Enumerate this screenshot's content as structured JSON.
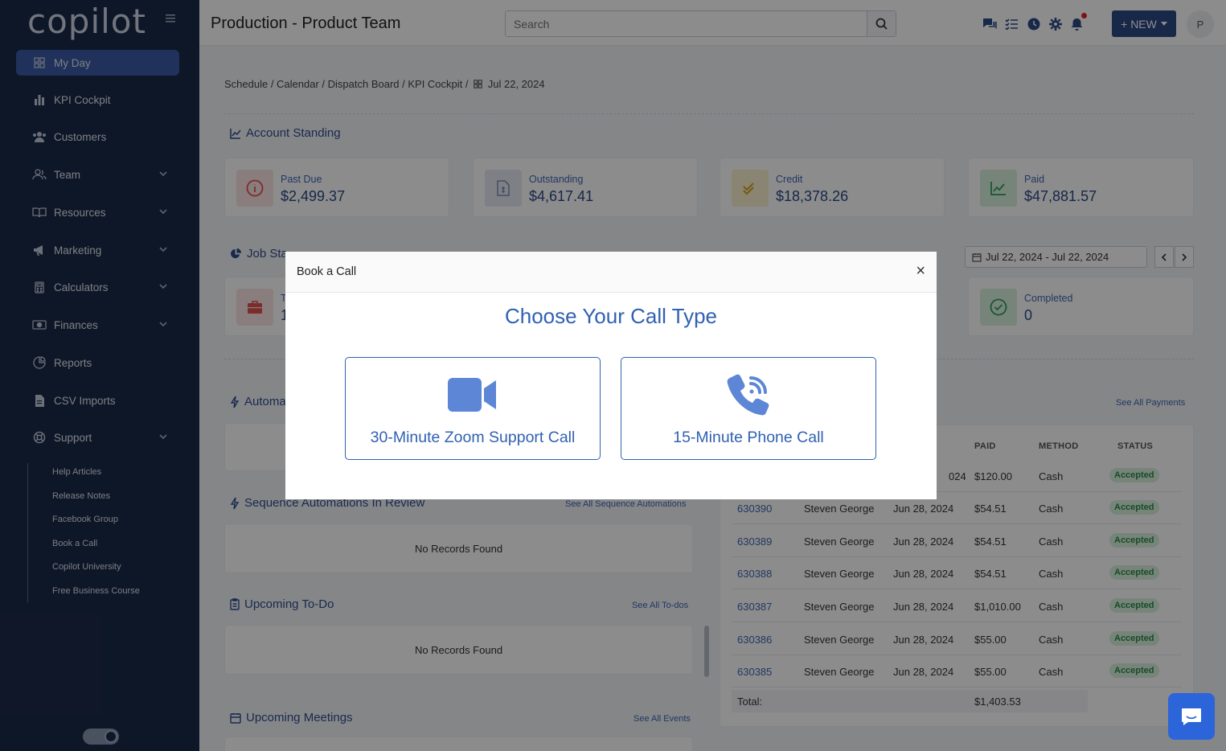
{
  "app": {
    "logo": "copilot",
    "page_title": "Production - Product Team"
  },
  "search": {
    "placeholder": "Search"
  },
  "header": {
    "new_label": "+ NEW",
    "avatar_initial": "P"
  },
  "sidebar": {
    "items": [
      {
        "label": "My Day",
        "icon": "grid-icon"
      },
      {
        "label": "KPI Cockpit",
        "icon": "bar-chart-icon"
      },
      {
        "label": "Customers",
        "icon": "users-icon"
      },
      {
        "label": "Team",
        "icon": "team-icon"
      },
      {
        "label": "Resources",
        "icon": "book-icon"
      },
      {
        "label": "Marketing",
        "icon": "megaphone-icon"
      },
      {
        "label": "Calculators",
        "icon": "calculator-icon"
      },
      {
        "label": "Finances",
        "icon": "money-icon"
      },
      {
        "label": "Reports",
        "icon": "pie-chart-icon"
      },
      {
        "label": "CSV Imports",
        "icon": "file-csv-icon"
      },
      {
        "label": "Support",
        "icon": "lifebuoy-icon"
      }
    ],
    "support_links": [
      "Help Articles",
      "Release Notes",
      "Facebook Group",
      "Book a Call",
      "Copilot University",
      "Free Business Course"
    ]
  },
  "breadcrumb": {
    "path": "Schedule / Calendar / Dispatch Board / KPI Cockpit /",
    "date": "Jul 22, 2024"
  },
  "account_standing": {
    "title": "Account Standing",
    "cards": [
      {
        "label": "Past Due",
        "value": "$2,499.37",
        "color": "#e05252"
      },
      {
        "label": "Outstanding",
        "value": "$4,617.41",
        "color": "#7c8db5"
      },
      {
        "label": "Credit",
        "value": "$18,378.26",
        "color": "#d4a418"
      },
      {
        "label": "Paid",
        "value": "$47,881.57",
        "color": "#2e9e5b"
      }
    ]
  },
  "job_stats": {
    "title_visible": "Job Sta",
    "date_range": "Jul 22, 2024 - Jul 22, 2024",
    "first_card_label": "T",
    "first_card_value": "1",
    "completed_label": "Completed",
    "completed_value": "0"
  },
  "automations": {
    "title_visible": "Automa"
  },
  "sequence_automations": {
    "title": "Sequence Automations In Review",
    "link": "See All Sequence Automations",
    "empty": "No Records Found"
  },
  "upcoming_todo": {
    "title": "Upcoming To-Do",
    "link": "See All To-dos",
    "empty": "No Records Found"
  },
  "upcoming_meetings": {
    "title": "Upcoming Meetings",
    "link": "See All Events"
  },
  "payments": {
    "link": "See All Payments",
    "headers": [
      "PAID",
      "METHOD",
      "STATUS"
    ],
    "partial_first_row": {
      "date_tail": "024",
      "paid": "$120.00",
      "method": "Cash",
      "status": "Accepted"
    },
    "rows": [
      {
        "job": "630390",
        "customer": "Steven George",
        "date": "Jun 28, 2024",
        "paid": "$54.51",
        "method": "Cash",
        "status": "Accepted"
      },
      {
        "job": "630389",
        "customer": "Steven George",
        "date": "Jun 28, 2024",
        "paid": "$54.51",
        "method": "Cash",
        "status": "Accepted"
      },
      {
        "job": "630388",
        "customer": "Steven George",
        "date": "Jun 28, 2024",
        "paid": "$54.51",
        "method": "Cash",
        "status": "Accepted"
      },
      {
        "job": "630387",
        "customer": "Steven George",
        "date": "Jun 28, 2024",
        "paid": "$1,010.00",
        "method": "Cash",
        "status": "Accepted"
      },
      {
        "job": "630386",
        "customer": "Steven George",
        "date": "Jun 28, 2024",
        "paid": "$55.00",
        "method": "Cash",
        "status": "Accepted"
      },
      {
        "job": "630385",
        "customer": "Steven George",
        "date": "Jun 28, 2024",
        "paid": "$55.00",
        "method": "Cash",
        "status": "Accepted"
      }
    ],
    "total_label": "Total:",
    "total_value": "$1,403.53"
  },
  "modal": {
    "title": "Book a Call",
    "close": "×",
    "heading": "Choose Your Call Type",
    "options": [
      {
        "label": "30-Minute Zoom Support Call",
        "icon": "video-camera-icon"
      },
      {
        "label": "15-Minute Phone Call",
        "icon": "phone-call-icon"
      }
    ]
  },
  "colors": {
    "sidebar_bg": "#1b2a4a",
    "accent": "#3161b1",
    "active_nav": "#3b5ca8",
    "badge_bg": "#d8f1de"
  }
}
